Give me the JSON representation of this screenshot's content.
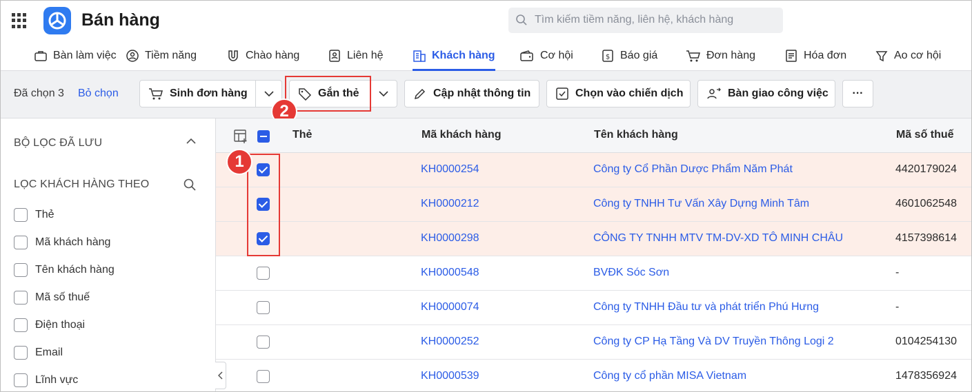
{
  "app": {
    "title": "Bán hàng"
  },
  "search": {
    "placeholder": "Tìm kiếm tiềm năng, liên hệ, khách hàng"
  },
  "nav": {
    "items": [
      {
        "label": "Bàn làm việc",
        "icon": "briefcase-icon"
      },
      {
        "label": "Tiềm năng",
        "icon": "user-circle-icon"
      },
      {
        "label": "Chào hàng",
        "icon": "magnet-icon"
      },
      {
        "label": "Liên hệ",
        "icon": "contact-card-icon"
      },
      {
        "label": "Khách hàng",
        "icon": "building-icon",
        "active": true
      },
      {
        "label": "Cơ hội",
        "icon": "wallet-icon"
      },
      {
        "label": "Báo giá",
        "icon": "dollar-document-icon"
      },
      {
        "label": "Đơn hàng",
        "icon": "cart-icon"
      },
      {
        "label": "Hóa đơn",
        "icon": "invoice-icon"
      },
      {
        "label": "Ao cơ hội",
        "icon": "funnel-icon"
      }
    ]
  },
  "toolbar": {
    "selected_count": "Đã chọn 3",
    "unselect": "Bỏ chọn",
    "create_order": "Sinh đơn hàng",
    "tag": "Gắn thẻ",
    "update_info": "Cập nhật thông tin",
    "add_campaign": "Chọn vào chiến dịch",
    "handover": "Bàn giao công việc",
    "more": "···"
  },
  "annotations": {
    "step1": "1",
    "step2": "2"
  },
  "sidebar": {
    "saved_filters": "BỘ LỌC ĐÃ LƯU",
    "filter_by": "LỌC KHÁCH HÀNG THEO",
    "fields": [
      "Thẻ",
      "Mã khách hàng",
      "Tên khách hàng",
      "Mã số thuế",
      "Điện thoại",
      "Email",
      "Lĩnh vực"
    ]
  },
  "table": {
    "columns": {
      "tag": "Thẻ",
      "code": "Mã khách hàng",
      "name": "Tên khách hàng",
      "tax": "Mã số thuế"
    },
    "rows": [
      {
        "checked": true,
        "tag": "",
        "code": "KH0000254",
        "name": "Công ty Cổ Phần Dược Phẩm Năm Phát",
        "tax": "4420179024"
      },
      {
        "checked": true,
        "tag": "",
        "code": "KH0000212",
        "name": "Công ty TNHH Tư Vấn Xây Dựng Minh Tâm",
        "tax": "4601062548"
      },
      {
        "checked": true,
        "tag": "",
        "code": "KH0000298",
        "name": "CÔNG TY TNHH MTV TM-DV-XD TÔ MINH CHÂU",
        "tax": "4157398614"
      },
      {
        "checked": false,
        "tag": "",
        "code": "KH0000548",
        "name": "BVĐK Sóc Sơn",
        "tax": "-"
      },
      {
        "checked": false,
        "tag": "",
        "code": "KH0000074",
        "name": "Công ty TNHH Đầu tư và phát triển Phú Hưng",
        "tax": "-"
      },
      {
        "checked": false,
        "tag": "",
        "code": "KH0000252",
        "name": "Công ty CP Hạ Tầng Và DV Truyền Thông Logi 2",
        "tax": "0104254130"
      },
      {
        "checked": false,
        "tag": "",
        "code": "KH0000539",
        "name": "Công ty cổ phần MISA Vietnam",
        "tax": "1478356924"
      }
    ]
  },
  "colors": {
    "accent": "#2b5ce6",
    "selected_row": "#fdeee8",
    "annotation": "#e53935"
  }
}
